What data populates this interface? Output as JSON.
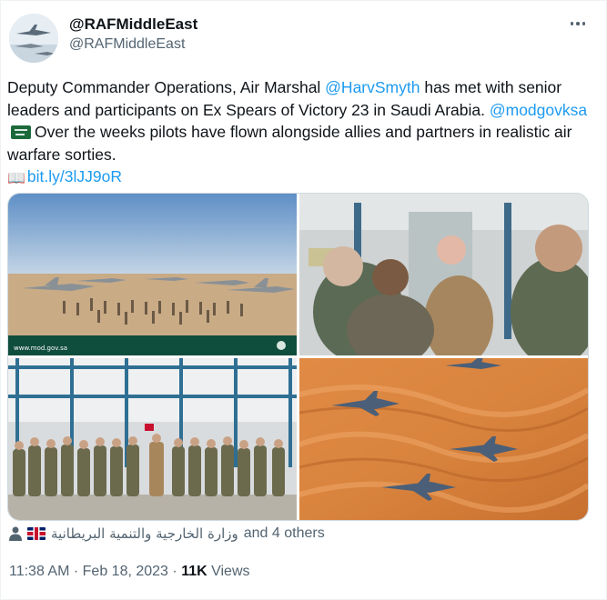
{
  "author": {
    "name": "@RAFMiddleEast",
    "handle": "@RAFMiddleEast"
  },
  "tweet": {
    "part1": "Deputy Commander Operations, Air Marshal ",
    "mention1": "@HarvSmyth",
    "part2": " has met with senior leaders and participants on Ex Spears of Victory 23 in Saudi Arabia. ",
    "mention2": "@modgovksa",
    "part3": "Over the weeks pilots have flown alongside allies and partners in realistic air warfare sorties.",
    "link": "bit.ly/3lJJ9oR",
    "book_icon": "book-icon",
    "flag_icon": "saudi-flag-icon"
  },
  "media": {
    "photo1_caption": "www.mod.gov.sa"
  },
  "social": {
    "arabic_name": "وزارة الخارجية والتنمية البريطانية",
    "others": "and 4 others"
  },
  "meta": {
    "time": "11:38 AM",
    "separator": "·",
    "date": "Feb 18, 2023",
    "separator2": "·",
    "views_count": "11K",
    "views_label": "Views"
  },
  "colors": {
    "link": "#1d9bf0",
    "secondary_text": "#536471",
    "primary_text": "#0f1419"
  }
}
